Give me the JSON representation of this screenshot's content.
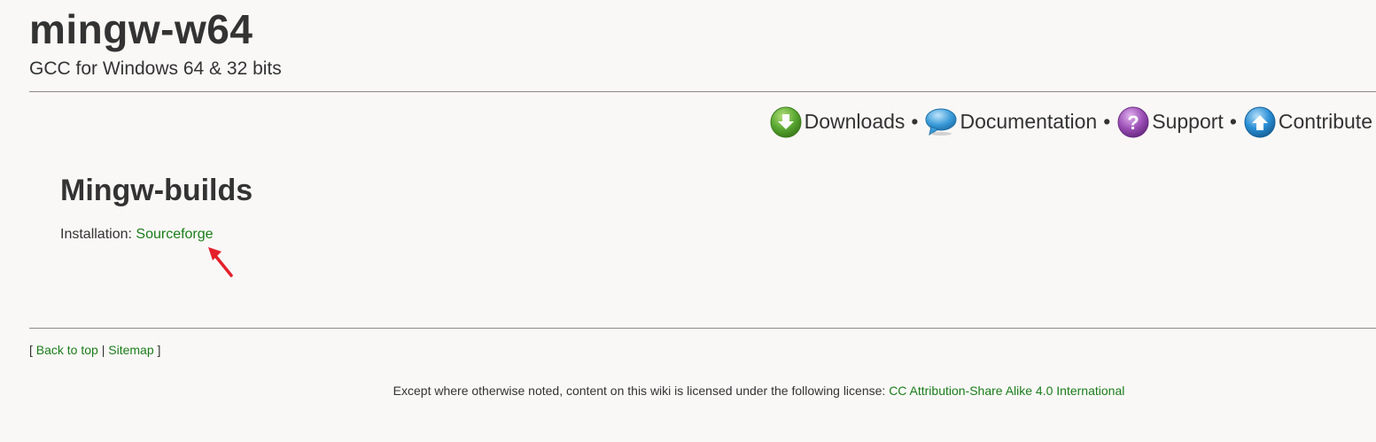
{
  "header": {
    "title": "mingw-w64",
    "tagline": "GCC for Windows 64 & 32 bits"
  },
  "nav": {
    "items": [
      {
        "label": "Downloads",
        "icon": "download-icon",
        "color": "#5aa832"
      },
      {
        "label": "Documentation",
        "icon": "speech-bubble-icon",
        "color": "#3a9bd9"
      },
      {
        "label": "Support",
        "icon": "question-icon",
        "color": "#9b4fb5"
      },
      {
        "label": "Contribute",
        "icon": "upload-icon",
        "color": "#2a8fd6"
      }
    ],
    "separator": "•"
  },
  "content": {
    "title": "Mingw-builds",
    "install_label": "Installation:",
    "install_link": "Sourceforge"
  },
  "annotation": {
    "arrow_color": "#e3202b"
  },
  "footer": {
    "open_bracket": "[",
    "back_to_top": "Back to top",
    "divider": "|",
    "sitemap": "Sitemap",
    "close_bracket": "]",
    "license_text": "Except where otherwise noted, content on this wiki is licensed under the following license:",
    "license_link": "CC Attribution-Share Alike 4.0 International"
  },
  "colors": {
    "link": "#1a7d1a",
    "text": "#333333",
    "background": "#faf8f7"
  }
}
